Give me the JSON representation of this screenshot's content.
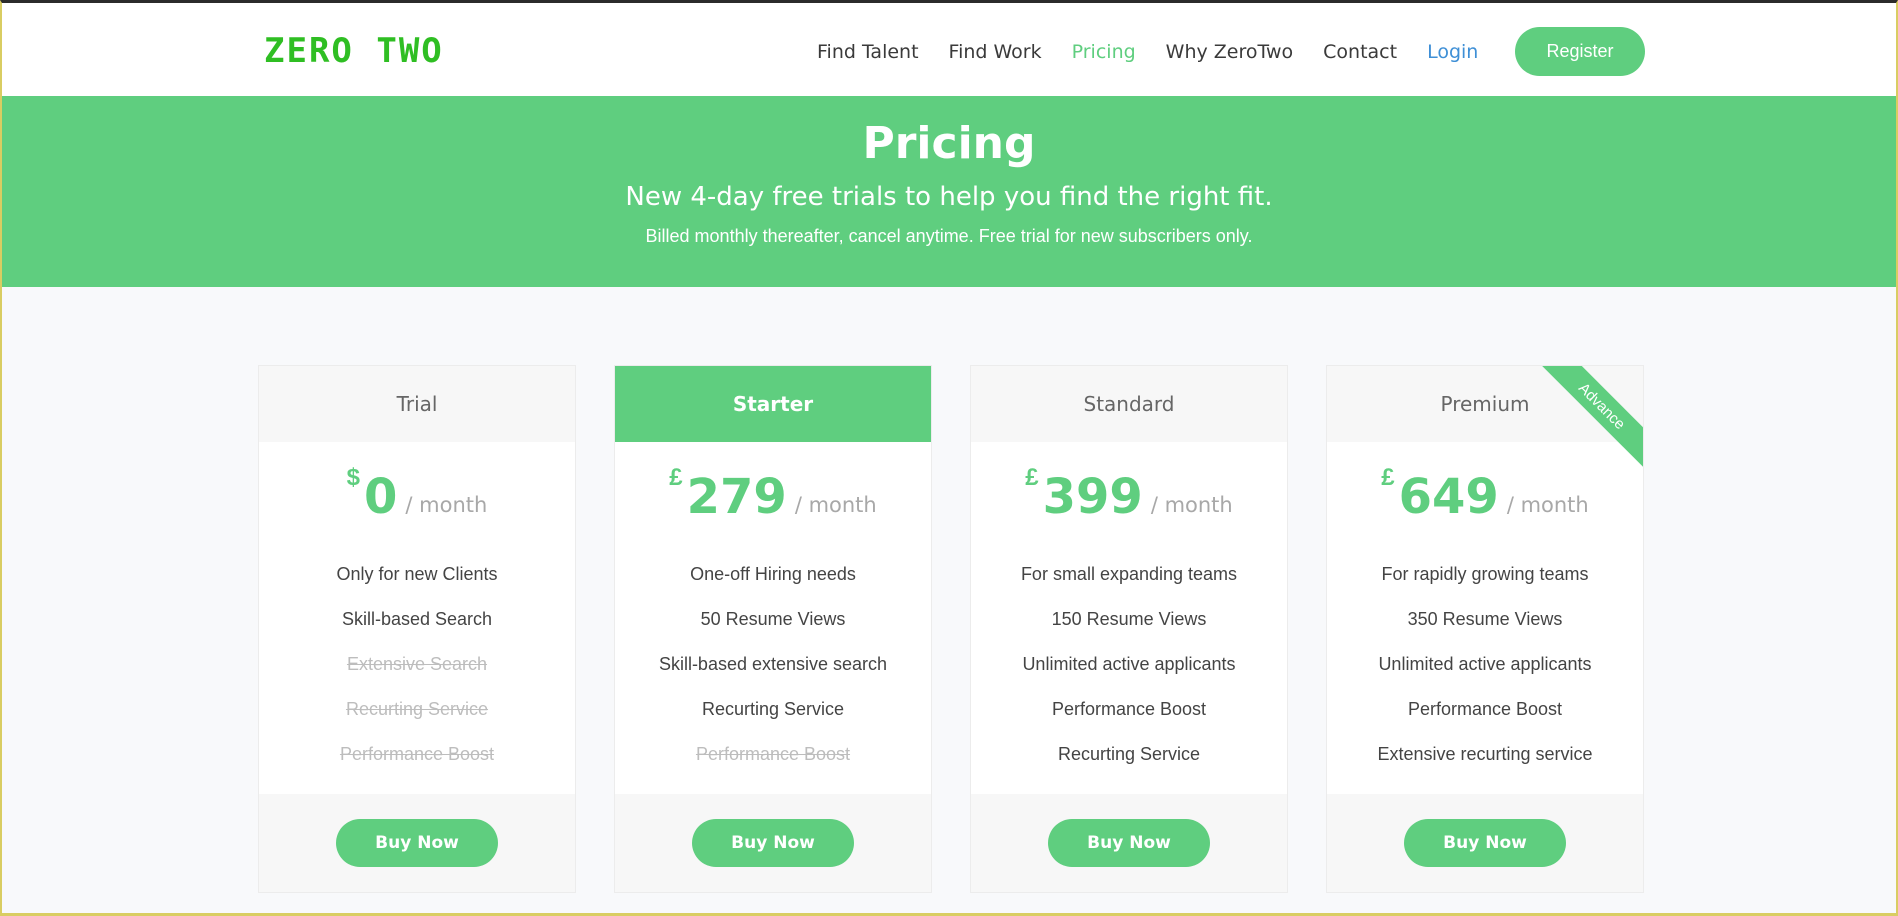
{
  "brand": {
    "logo_text": "ZERO TWO",
    "accent_color": "#5fce7f",
    "logo_color": "#2fbe23"
  },
  "nav": {
    "items": [
      {
        "label": "Find Talent"
      },
      {
        "label": "Find Work"
      },
      {
        "label": "Pricing",
        "active": true
      },
      {
        "label": "Why ZeroTwo"
      },
      {
        "label": "Contact"
      }
    ],
    "login_label": "Login",
    "register_label": "Register"
  },
  "hero": {
    "title": "Pricing",
    "subtitle": "New 4-day free trials to help you find the right fit.",
    "note": "Billed monthly thereafter, cancel anytime. Free trial for new subscribers only."
  },
  "plans": [
    {
      "name": "Trial",
      "currency": "$",
      "amount": "0",
      "period": "/ month",
      "features": [
        {
          "text": "Only for new Clients",
          "included": true
        },
        {
          "text": "Skill-based Search",
          "included": true
        },
        {
          "text": "Extensive Search",
          "included": false
        },
        {
          "text": "Recurting Service",
          "included": false
        },
        {
          "text": "Performance Boost",
          "included": false
        }
      ],
      "button": "Buy Now"
    },
    {
      "name": "Starter",
      "currency": "£",
      "amount": "279",
      "period": "/ month",
      "featured": true,
      "features": [
        {
          "text": "One-off Hiring needs",
          "included": true
        },
        {
          "text": "50 Resume Views",
          "included": true
        },
        {
          "text": "Skill-based extensive search",
          "included": true
        },
        {
          "text": "Recurting Service",
          "included": true
        },
        {
          "text": "Performance Boost",
          "included": false
        }
      ],
      "button": "Buy Now"
    },
    {
      "name": "Standard",
      "currency": "£",
      "amount": "399",
      "period": "/ month",
      "features": [
        {
          "text": "For small expanding teams",
          "included": true
        },
        {
          "text": "150 Resume Views",
          "included": true
        },
        {
          "text": "Unlimited active applicants",
          "included": true
        },
        {
          "text": "Performance Boost",
          "included": true
        },
        {
          "text": "Recurting Service",
          "included": true
        }
      ],
      "button": "Buy Now"
    },
    {
      "name": "Premium",
      "currency": "£",
      "amount": "649",
      "period": "/ month",
      "ribbon": "Advance",
      "features": [
        {
          "text": "For rapidly growing teams",
          "included": true
        },
        {
          "text": "350 Resume Views",
          "included": true
        },
        {
          "text": "Unlimited active applicants",
          "included": true
        },
        {
          "text": "Performance Boost",
          "included": true
        },
        {
          "text": "Extensive recurting service",
          "included": true
        }
      ],
      "button": "Buy Now"
    }
  ]
}
